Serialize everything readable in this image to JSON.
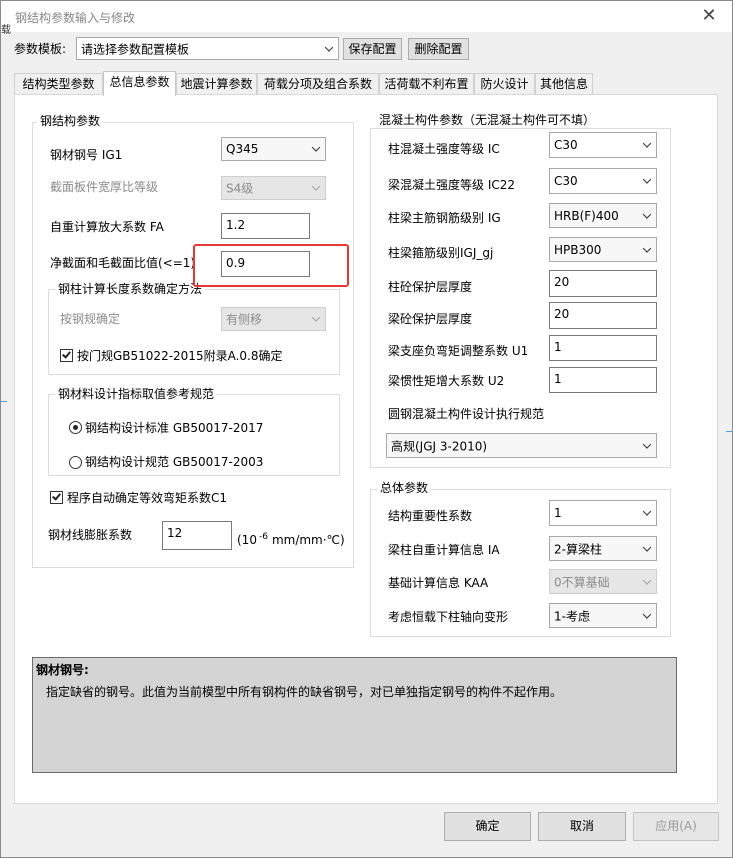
{
  "window": {
    "title": "钢结构参数输入与修改",
    "close_glyph": "✕",
    "edge_text": "载"
  },
  "template_row": {
    "label": "参数模板:",
    "select_value": "请选择参数配置模板",
    "save_button": "保存配置",
    "delete_button": "删除配置"
  },
  "tabs": [
    {
      "label": "结构类型参数"
    },
    {
      "label": "总信息参数"
    },
    {
      "label": "地震计算参数"
    },
    {
      "label": "荷载分项及组合系数"
    },
    {
      "label": "活荷载不利布置"
    },
    {
      "label": "防火设计"
    },
    {
      "label": "其他信息"
    }
  ],
  "steel": {
    "group_title": "钢结构参数",
    "ig1_label": "钢材钢号 IG1",
    "ig1_value": "Q345",
    "width_ratio_label": "截面板件宽厚比等级",
    "width_ratio_value": "S4级",
    "fa_label": "自重计算放大系数 FA",
    "fa_value": "1.2",
    "net_ratio_label": "净截面和毛截面比值(<=1)",
    "net_ratio_value": "0.9",
    "length_group_title": "钢柱计算长度系数确定方法",
    "by_code_label": "按钢规确定",
    "by_code_value": "有侧移",
    "portal_check_label": "按门规GB51022-2015附录A.0.8确定",
    "spec_group_title": "钢材料设计指标取值参考规范",
    "radio_standard": "钢结构设计标准 GB50017-2017",
    "radio_code": "钢结构设计规范 GB50017-2003",
    "auto_c1_label": "程序自动确定等效弯矩系数C1",
    "expansion_label": "钢材线膨胀系数",
    "expansion_value": "12",
    "expansion_unit_pre": "(10",
    "expansion_unit_exp": "-6",
    "expansion_unit_post": "mm/mm·℃)"
  },
  "concrete": {
    "group_title": "混凝土构件参数（无混凝土构件可不填）",
    "ic_label": "柱混凝土强度等级 IC",
    "ic_value": "C30",
    "ic22_label": "梁混凝土强度等级 IC22",
    "ic22_value": "C30",
    "ig_label": "柱梁主筋钢筋级别 IG",
    "ig_value": "HRB(F)400",
    "igj_label": "柱梁箍筋级别IGJ_gj",
    "igj_value": "HPB300",
    "col_cover_label": "柱砼保护层厚度",
    "col_cover_value": "20",
    "beam_cover_label": "梁砼保护层厚度",
    "beam_cover_value": "20",
    "u1_label": "梁支座负弯矩调整系数 U1",
    "u1_value": "1",
    "u2_label": "梁惯性矩增大系数 U2",
    "u2_value": "1",
    "round_label": "圆钢混凝土构件设计执行规范",
    "round_value": "高规(JGJ 3-2010)"
  },
  "general": {
    "group_title": "总体参数",
    "importance_label": "结构重要性系数",
    "importance_value": "1",
    "ia_label": "梁柱自重计算信息 IA",
    "ia_value": "2-算梁柱",
    "kaa_label": "基础计算信息 KAA",
    "kaa_value": "0不算基础",
    "axial_label": "考虑恒载下柱轴向变形",
    "axial_value": "1-考虑"
  },
  "description": {
    "title": "钢材钢号:",
    "text": "指定缺省的钢号。此值为当前模型中所有钢构件的缺省钢号，对已单独指定钢号的构件不起作用。"
  },
  "footer": {
    "ok": "确定",
    "cancel": "取消",
    "apply": "应用(A)"
  },
  "colors": {
    "highlight_box": "#e53935",
    "background_line": "#4aa3d9"
  }
}
